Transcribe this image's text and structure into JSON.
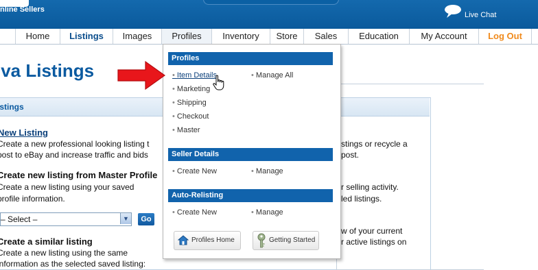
{
  "header": {
    "logo_fragment": "nline Sellers",
    "chat_label": "Live Chat"
  },
  "nav": {
    "items": [
      "Home",
      "Listings",
      "Images",
      "Profiles",
      "Inventory",
      "Store",
      "Sales",
      "Education",
      "My Account",
      "Log Out"
    ],
    "active": "Listings",
    "open": "Profiles"
  },
  "page": {
    "title": "iva Listings",
    "panel_title": "istings",
    "new_listing_link": "New Listing",
    "new_listing_desc1": "Create a new professional looking listing t",
    "new_listing_desc2": "post to eBay and increase traffic and bids",
    "master_heading": "Create new listing from Master Profile",
    "master_desc1": "Create a new listing using your saved",
    "master_desc2": "profile information.",
    "select_value": "– Select –",
    "go_label": "Go",
    "similar_heading": "Create a similar listing",
    "similar_desc1": "Create a new listing using the same",
    "similar_desc2": "information as the selected saved listing:",
    "right_lines": [
      "stings or recycle a",
      "post.",
      "r selling activity.",
      "led listings.",
      "w of your current",
      "r active listings on"
    ]
  },
  "dropdown": {
    "profiles": {
      "title": "Profiles",
      "left": [
        "Item Details",
        "Marketing",
        "Shipping",
        "Checkout",
        "Master"
      ],
      "right": [
        "Manage All"
      ]
    },
    "seller": {
      "title": "Seller Details",
      "left": [
        "Create New"
      ],
      "right": [
        "Manage"
      ]
    },
    "relist": {
      "title": "Auto-Relisting",
      "left": [
        "Create New"
      ],
      "right": [
        "Manage"
      ]
    },
    "buttons": {
      "profiles_home": "Profiles Home",
      "getting_started": "Getting Started"
    }
  },
  "colors": {
    "header_blue": "#0a5a9c",
    "section_blue": "#1163ac",
    "logout_orange": "#f08a1c",
    "pointer_red": "#e8161b"
  },
  "icons": [
    "chat-bubble-icon",
    "house-icon",
    "key-icon",
    "hand-cursor-icon",
    "red-arrow-pointer"
  ]
}
